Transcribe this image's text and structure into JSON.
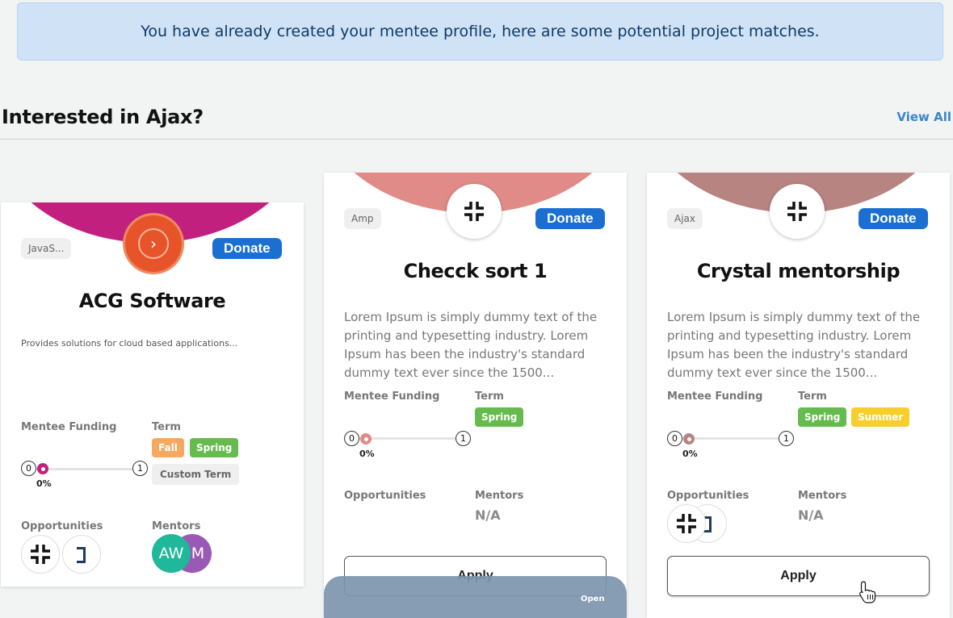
{
  "alert": {
    "text": "You have already created your mentee profile, here are some potential project matches."
  },
  "section": {
    "title": "Interested in Ajax?",
    "view_all": "View All"
  },
  "labels": {
    "mentee_funding": "Mentee Funding",
    "term": "Term",
    "opportunities": "Opportunities",
    "mentors": "Mentors",
    "donate": "Donate",
    "apply": "Apply",
    "min": "0",
    "max": "1",
    "na": "N/A"
  },
  "cards": [
    {
      "tag": "JavaS...",
      "title": "ACG Software",
      "description": "Provides solutions for cloud based applications...",
      "funding_percent_label": "0%",
      "funding_fraction": 0,
      "terms": [
        "Fall",
        "Spring",
        "Custom Term"
      ],
      "mentors": [
        "AW",
        "M"
      ],
      "accent_color": "#c2207f",
      "logo": "chevron-right-icon"
    },
    {
      "tag": "Amp",
      "title": "Checck sort 1",
      "description": "Lorem Ipsum is simply dummy text of the printing and typesetting industry. Lorem Ipsum has been the industry's standard dummy text ever since the 1500...",
      "funding_percent_label": "0%",
      "funding_fraction": 0,
      "terms": [
        "Spring"
      ],
      "mentors_text": "N/A",
      "accent_color": "#e08b87",
      "logo": "compress-icon",
      "open_label": "Open"
    },
    {
      "tag": "Ajax",
      "title": "Crystal mentorship",
      "description": "Lorem Ipsum is simply dummy text of the printing and typesetting industry. Lorem Ipsum has been the industry's standard dummy text ever since the 1500...",
      "funding_percent_label": "0%",
      "funding_fraction": 0,
      "terms": [
        "Spring",
        "Summer"
      ],
      "mentors_text": "N/A",
      "accent_color": "#b78482",
      "logo": "compress-icon"
    }
  ],
  "colors": {
    "donate": "#1a6fd1",
    "spring": "#66bb4e",
    "fall": "#f6a860",
    "summer": "#f7cf2c",
    "mentor_aw": "#1fb89a",
    "mentor_m": "#9b59b6"
  }
}
